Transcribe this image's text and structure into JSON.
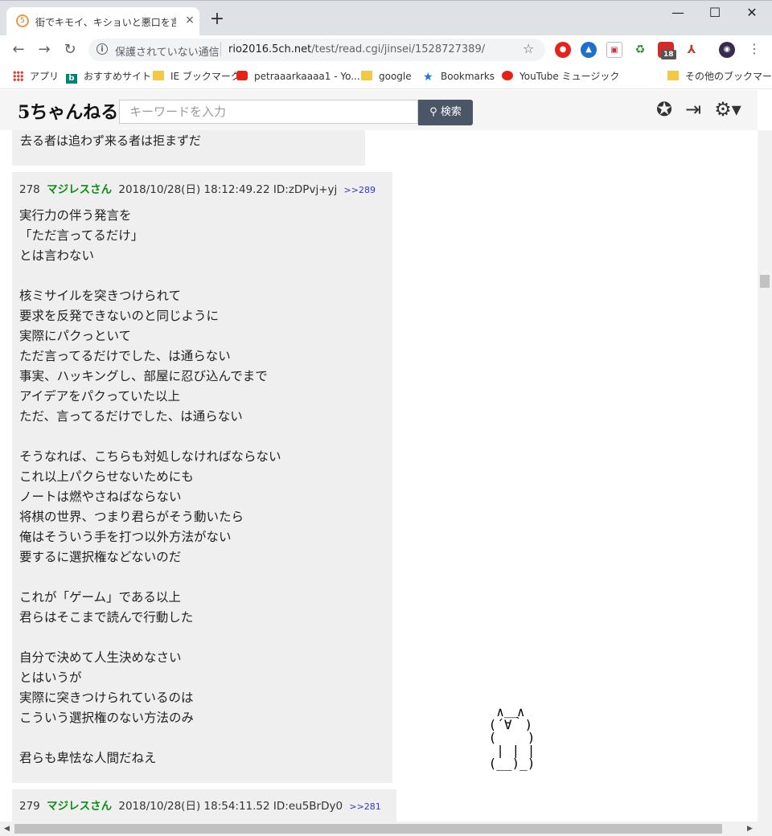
{
  "browser": {
    "tab_title": "街でキモイ、キショいと悪口を言われる",
    "tab_close": "×",
    "new_tab": "+",
    "window_controls": [
      "—",
      "☐",
      "✕"
    ],
    "nav": {
      "back": "←",
      "forward": "→",
      "reload": "↻"
    },
    "security_label": "保護されていない通信",
    "url_host": "rio2016.5ch.net",
    "url_path": "/test/read.cgi/jinsei/1528727389/",
    "extension_badge": "18",
    "bookmarks": [
      {
        "label": "アプリ",
        "icon": "apps-grid-icon"
      },
      {
        "label": "おすすめサイト",
        "icon": "bing-icon"
      },
      {
        "label": "IE ブックマーク",
        "icon": "folder-icon"
      },
      {
        "label": "petraaarkaaaa1 - Yo...",
        "icon": "youtube-icon"
      },
      {
        "label": "google",
        "icon": "folder-icon"
      },
      {
        "label": "Bookmarks",
        "icon": "star-icon"
      },
      {
        "label": "YouTube ミュージック",
        "icon": "youtube-music-icon"
      },
      {
        "label": "その他のブックマーク",
        "icon": "folder-icon"
      }
    ],
    "colors": {
      "tabstrip": "#dee1e6",
      "omnibox": "#f1f3f4"
    }
  },
  "site": {
    "logo": "5ちゃんねる",
    "search_placeholder": "キーワードを入力",
    "search_button": "検索",
    "header_icons": [
      "badge-icon",
      "login-icon",
      "settings-gear-icon"
    ]
  },
  "posts": {
    "prev": {
      "last_line": "去る者は追わず来る者は拒まずだ"
    },
    "p278": {
      "number": "278",
      "name": "マジレスさん",
      "datetime": "2018/10/28(日) 18:12:49.22 ID:zDPvj+yj",
      "reply": ">>289",
      "lines": [
        "実行力の伴う発言を",
        "「ただ言ってるだけ」",
        "とは言わない",
        "",
        "核ミサイルを突きつけられて",
        "要求を反発できないのと同じように",
        "実際にパクっといて",
        "ただ言ってるだけでした、は通らない",
        "事実、ハッキングし、部屋に忍び込んでまで",
        "アイデアをパクっていた以上",
        "ただ、言ってるだけでした、は通らない",
        "",
        "そうなれば、こちらも対処しなければならない",
        "これ以上パクらせないためにも",
        "ノートは燃やさねばならない",
        "将棋の世界、つまり君らがそう動いたら",
        "俺はそういう手を打つ以外方法がない",
        "要するに選択権などないのだ",
        "",
        "これが「ゲーム」である以上",
        "君らはそこまで読んで行動した",
        "",
        "自分で決めて人生決めなさい",
        "とはいうが",
        "実際に突きつけられているのは",
        "こういう選択権のない方法のみ",
        "",
        "君らも卑怯な人間だねえ"
      ]
    },
    "p279": {
      "number": "279",
      "name": "マジレスさん",
      "datetime": "2018/10/28(日) 18:54:11.52 ID:eu5BrDy0",
      "reply": ">>281"
    },
    "name_color": "#0a8c14",
    "post_bg": "#efefef"
  },
  "ascii_art": "  ∧＿∧\n (´∀｀)\n (    )\n  | | |\n (__)_)"
}
